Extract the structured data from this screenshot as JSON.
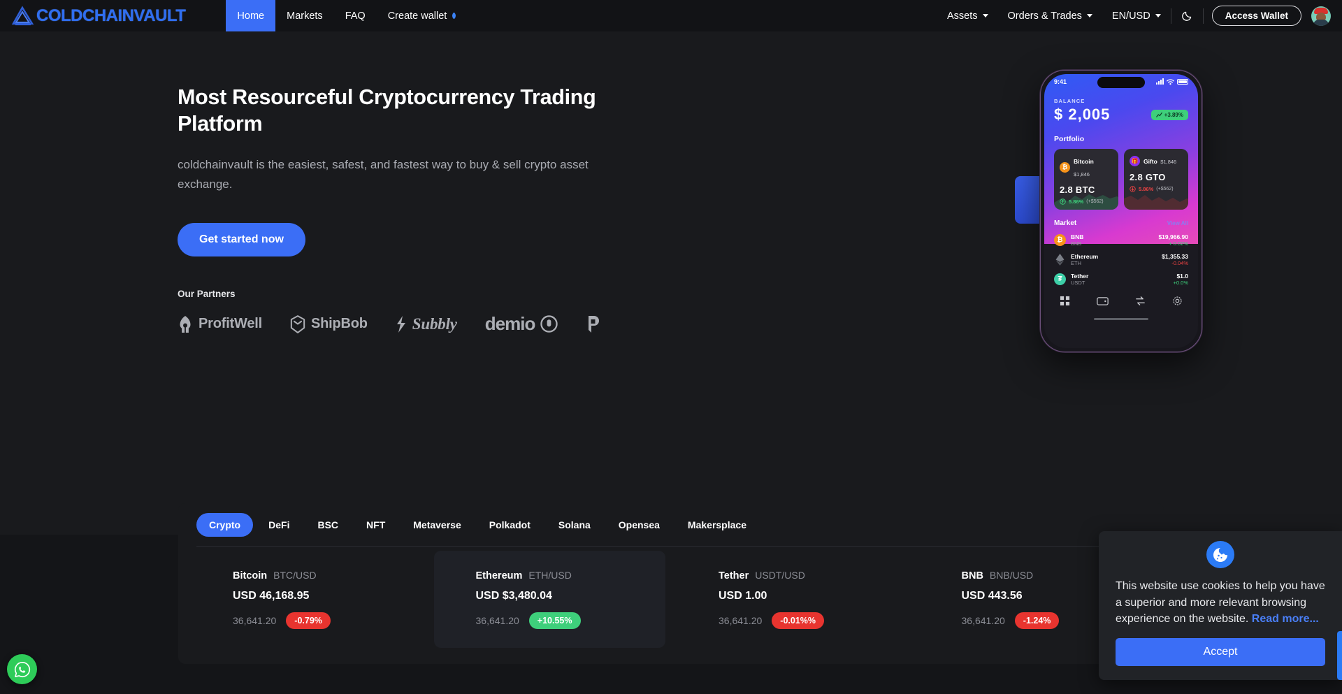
{
  "brand": {
    "name": "COLDCHAINVAULT",
    "logo_icon": "triangle-knot-logo",
    "color": "#2f6ef0"
  },
  "nav": {
    "links": [
      {
        "label": "Home",
        "active": true
      },
      {
        "label": "Markets",
        "active": false
      },
      {
        "label": "FAQ",
        "active": false
      },
      {
        "label": "Create wallet",
        "active": false,
        "badge_icon": "diamond-icon"
      }
    ],
    "right": {
      "assets_label": "Assets",
      "orders_label": "Orders & Trades",
      "locale_label": "EN/USD",
      "theme_icon": "moon-icon",
      "access_wallet_label": "Access Wallet",
      "avatar_icon": "user-avatar"
    }
  },
  "hero": {
    "title": "Most Resourceful Cryptocurrency Trading Platform",
    "subtitle": "coldchainvault is the easiest, safest, and fastest way to buy & sell crypto asset exchange.",
    "cta_label": "Get started now",
    "partners_label": "Our Partners",
    "partners": [
      {
        "name": "ProfitWell",
        "icon": "profitwell-icon"
      },
      {
        "name": "ShipBob",
        "icon": "shipbob-icon"
      },
      {
        "name": "Subbly",
        "icon": "subbly-icon"
      },
      {
        "name": "demio",
        "icon": "demio-icon"
      },
      {
        "name": "",
        "icon": "p-mark-icon"
      }
    ]
  },
  "phone": {
    "status": {
      "time": "9:41",
      "signal_icon": "signal-icon",
      "wifi_icon": "wifi-icon",
      "battery_icon": "battery-icon"
    },
    "balance_label": "BALANCE",
    "balance_value": "$ 2,005",
    "balance_change": "+3.89%",
    "portfolio_label": "Portfolio",
    "portfolio": [
      {
        "name": "Bitcoin",
        "usd": "$1,846",
        "amount": "2.8 BTC",
        "change": "5.86%",
        "change_amount": "(+$562)",
        "direction": "up",
        "icon": "bitcoin-icon"
      },
      {
        "name": "Gifto",
        "usd": "$1,846",
        "amount": "2.8 GTO",
        "change": "5.86%",
        "change_amount": "(+$562)",
        "direction": "down",
        "icon": "gift-icon"
      }
    ],
    "market_label": "Market",
    "view_all_label": "View All",
    "market": [
      {
        "name": "BNB",
        "symbol": "BNB",
        "price": "$19,966.90",
        "change": "+ 0.02%",
        "direction": "up",
        "icon": "bnb-icon"
      },
      {
        "name": "Ethereum",
        "symbol": "ETH",
        "price": "$1,355.33",
        "change": "-0.04%",
        "direction": "down",
        "icon": "ethereum-icon"
      },
      {
        "name": "Tether",
        "symbol": "USDT",
        "price": "$1.0",
        "change": "+0.0%",
        "direction": "up",
        "icon": "tether-icon"
      }
    ],
    "tabbar": [
      "grid-icon",
      "wallet-icon",
      "swap-icon",
      "gear-icon"
    ]
  },
  "markets": {
    "tabs": [
      {
        "label": "Crypto",
        "active": true
      },
      {
        "label": "DeFi",
        "active": false
      },
      {
        "label": "BSC",
        "active": false
      },
      {
        "label": "NFT",
        "active": false
      },
      {
        "label": "Metaverse",
        "active": false
      },
      {
        "label": "Polkadot",
        "active": false
      },
      {
        "label": "Solana",
        "active": false
      },
      {
        "label": "Opensea",
        "active": false
      },
      {
        "label": "Makersplace",
        "active": false
      }
    ],
    "cards": [
      {
        "name": "Bitcoin",
        "pair": "BTC/USD",
        "price": "USD 46,168.95",
        "volume": "36,641.20",
        "change": "-0.79%",
        "direction": "neg",
        "selected": false
      },
      {
        "name": "Ethereum",
        "pair": "ETH/USD",
        "price": "USD $3,480.04",
        "volume": "36,641.20",
        "change": "+10.55%",
        "direction": "pos",
        "selected": true
      },
      {
        "name": "Tether",
        "pair": "USDT/USD",
        "price": "USD 1.00",
        "volume": "36,641.20",
        "change": "-0.01%%",
        "direction": "neg",
        "selected": false
      },
      {
        "name": "BNB",
        "pair": "BNB/USD",
        "price": "USD 443.56",
        "volume": "36,641.20",
        "change": "-1.24%",
        "direction": "neg",
        "selected": false
      }
    ]
  },
  "cookie": {
    "icon": "cookie-icon",
    "text": "This website use cookies to help you have a superior and more relevant browsing experience on the website.",
    "link_label": "Read more...",
    "accept_label": "Accept"
  },
  "fab": {
    "icon": "whatsapp-icon"
  },
  "colors": {
    "accent": "#3b6ef6",
    "positive": "#3ecf7b",
    "negative": "#e8342f",
    "bg": "#191a1d",
    "panel": "#141518"
  }
}
